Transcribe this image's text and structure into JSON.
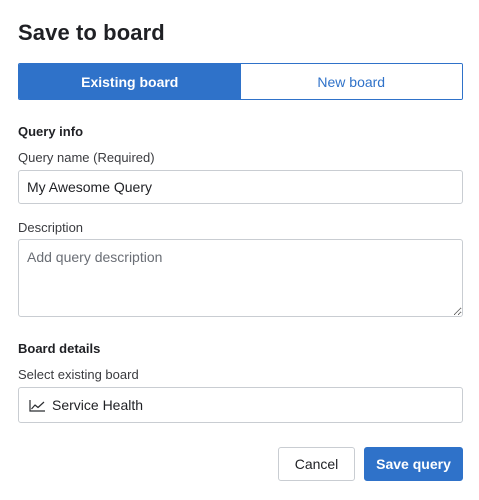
{
  "dialog": {
    "title": "Save to board"
  },
  "tabs": [
    {
      "label": "Existing board",
      "active": true
    },
    {
      "label": "New board",
      "active": false
    }
  ],
  "query_info": {
    "heading": "Query info",
    "name_label": "Query name (Required)",
    "name_value": "My Awesome Query",
    "description_label": "Description",
    "description_placeholder": "Add query description",
    "description_value": ""
  },
  "board_details": {
    "heading": "Board details",
    "select_label": "Select existing board",
    "selected_board": "Service Health",
    "selected_icon": "line-chart-icon"
  },
  "actions": {
    "cancel_label": "Cancel",
    "save_label": "Save query"
  },
  "colors": {
    "accent": "#2f72c9",
    "border": "#c9cdd2",
    "text": "#1f2024"
  }
}
